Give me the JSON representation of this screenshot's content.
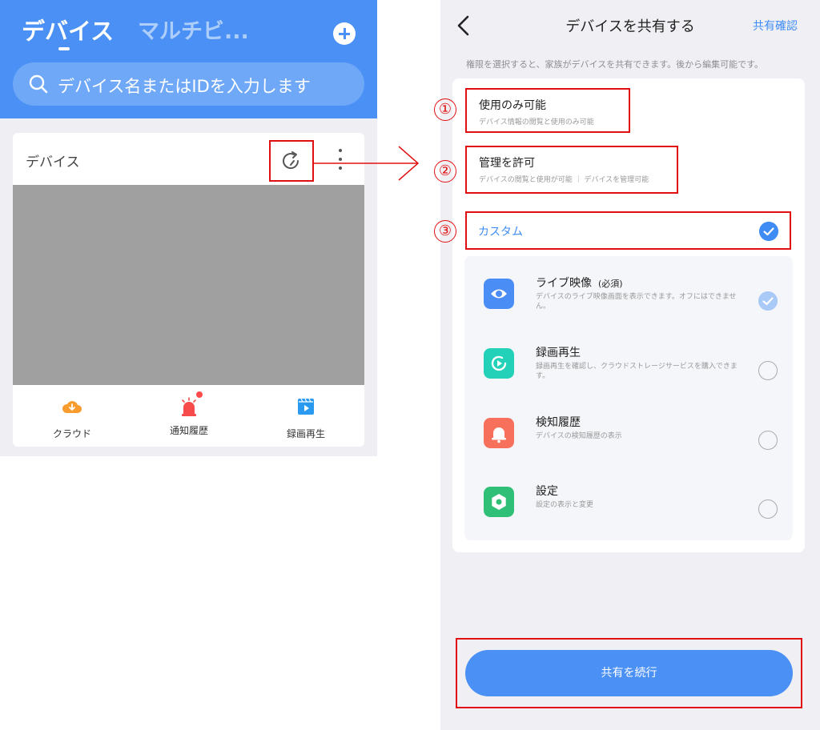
{
  "left": {
    "tabs": [
      "デバイス",
      "マルチビ..."
    ],
    "search": {
      "placeholder": "デバイス名またはIDを入力します"
    },
    "card": {
      "title": "デバイス",
      "buttons": [
        {
          "label": "クラウド",
          "icon": "cloud-icon"
        },
        {
          "label": "通知履歴",
          "icon": "alarm-icon"
        },
        {
          "label": "録画再生",
          "icon": "playback-icon"
        }
      ]
    }
  },
  "right": {
    "title": "デバイスを共有する",
    "confirm": "共有確認",
    "hint": "権限を選択すると、家族がデバイスを共有できます。後から編集可能です。",
    "options": [
      {
        "num": "①",
        "title": "使用のみ可能",
        "sub": "デバイス情報の閲覧と使用のみ可能"
      },
      {
        "num": "②",
        "title": "管理を許可",
        "sub": "デバイスの閲覧と使用が可能 ｜ デバイスを管理可能"
      },
      {
        "num": "③",
        "title": "カスタム"
      }
    ],
    "features": [
      {
        "title": "ライブ映像",
        "note": "(必須)",
        "desc": "デバイスのライブ映像画面を表示できます。オフにはできません。",
        "icon": "eye-icon",
        "color": "#4a8df5",
        "selected": true,
        "disabled": true
      },
      {
        "title": "録画再生",
        "desc": "録画再生を確認し、クラウドストレージサービスを購入できます。",
        "icon": "replay-icon",
        "color": "#22d1b8",
        "selected": false
      },
      {
        "title": "検知履歴",
        "desc": "デバイスの検知履歴の表示",
        "icon": "bell-icon",
        "color": "#f7705b",
        "selected": false
      },
      {
        "title": "設定",
        "desc": "設定の表示と変更",
        "icon": "settings-icon",
        "color": "#2fbf76",
        "selected": false
      }
    ],
    "continue": "共有を続行"
  },
  "colors": {
    "primary": "#4a90f5",
    "link": "#3f8cf5",
    "highlight": "#e01010"
  }
}
